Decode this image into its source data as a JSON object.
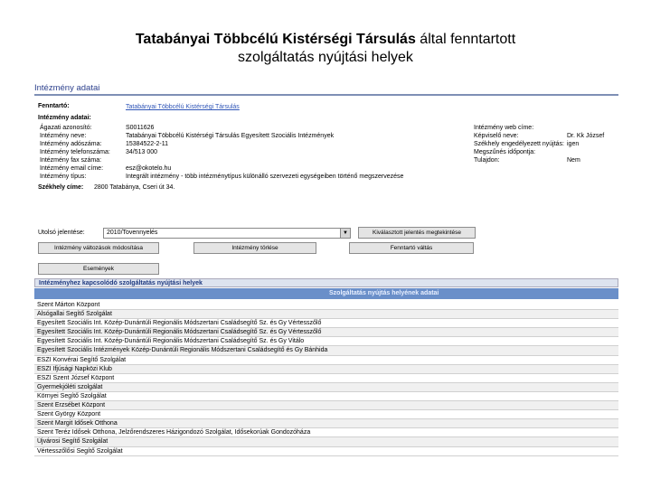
{
  "slide": {
    "title_bold": "Tatabányai Többcélú Kistérségi Társulás",
    "title_rest": " által fenntartott",
    "title_line2": "szolgáltatás nyújtási helyek"
  },
  "panel": {
    "header": "Intézmény adatai",
    "fenntarto_label": "Fenntartó:",
    "fenntarto_value": "Tatabányai Többcélú Kistérségi Társulás",
    "section_label": "Intézmény adatai:",
    "fields": [
      {
        "label": "Ágazati azonosító:",
        "value": "S0011626"
      },
      {
        "label": "Intézmény neve:",
        "value": "Tatabányai Többcélú Kistérségi Társulás Egyesített Szociális Intézmények"
      },
      {
        "label": "Intézmény adószáma:",
        "value": "15384522-2-11"
      },
      {
        "label": "Intézmény telefonszáma:",
        "value": "34/513 000"
      },
      {
        "label": "Intézmény fax száma:",
        "value": ""
      },
      {
        "label": "Intézmény email címe:",
        "value": "esz@okotelo.hu"
      },
      {
        "label": "Intézmény típus:",
        "value": "Integrált intézmény - több intézménytípus különálló szervezeti egységeiben történő megszervezése"
      }
    ],
    "right_fields": [
      {
        "label": "Intézmény web címe:",
        "value": ""
      },
      {
        "label": "Képviselő neve:",
        "value": "Dr. Kk József"
      },
      {
        "label": "Székhely engedélyezett nyújtás:",
        "value": "igen"
      },
      {
        "label": "Megszűnés időpontja:",
        "value": ""
      },
      {
        "label": "Tulajdon:",
        "value": "Nem"
      }
    ],
    "szekhely_label": "Székhely címe:",
    "szekhely_value": "2800 Tatabánya, Cseri út 34.",
    "utolso_label": "Utolsó jelentése:",
    "utolso_value": "2010/Tovennyelés",
    "buttons": {
      "b1": "Kiválasztott jelentés megtekintése",
      "b2": "Intézmény változások módosítása",
      "b3": "Intézmény törlése",
      "b4": "Fenntartó váltás",
      "b5": "Események"
    },
    "sub_header": "Intézményhez kapcsolódó szolgáltatás nyújtási helyek",
    "col_header_1": "",
    "col_header_2": "Szolgáltatás nyújtás helyének adatai",
    "rows": [
      "Szent Márton Központ",
      "Alsógallai Segítő Szolgálat",
      "Egyesített Szociális Int. Közép-Dunántúli Regionális Módszertani Családsegítő Sz. és Gy Vértesszőlő",
      "Egyesített Szociális Int. Közép-Dunántúli Regionális Módszertani Családsegítő Sz. és Gy Vértesszőlő",
      "Egyesített Szociális Int. Közép-Dunántúli Regionális Módszertani Családsegítő Sz. és Gy Vitálo",
      "Egyesített Szociális Intézmények Közép-Dunántúli Regionális Módszertani Családsegítő és Gy Bánhida",
      "ESZI Konvérai Segítő Szolgálat",
      "ESZI Ifjúsági Napközi Klub",
      "ESZI Szent József Központ",
      "Gyermekjóléti szolgálat",
      "Környei Segítő Szolgálat",
      "Szent Erzsébet Központ",
      "Szent György Központ",
      "Szent Margit Idősek Otthona",
      "Szent Teréz Idősek Otthona, Jelzőrendszeres Házigondozó Szolgálat, Idősekorúak Gondozóháza",
      "Újvárosi Segítő Szolgálat",
      "Vértesszőlősi Segítő Szolgálat"
    ]
  }
}
